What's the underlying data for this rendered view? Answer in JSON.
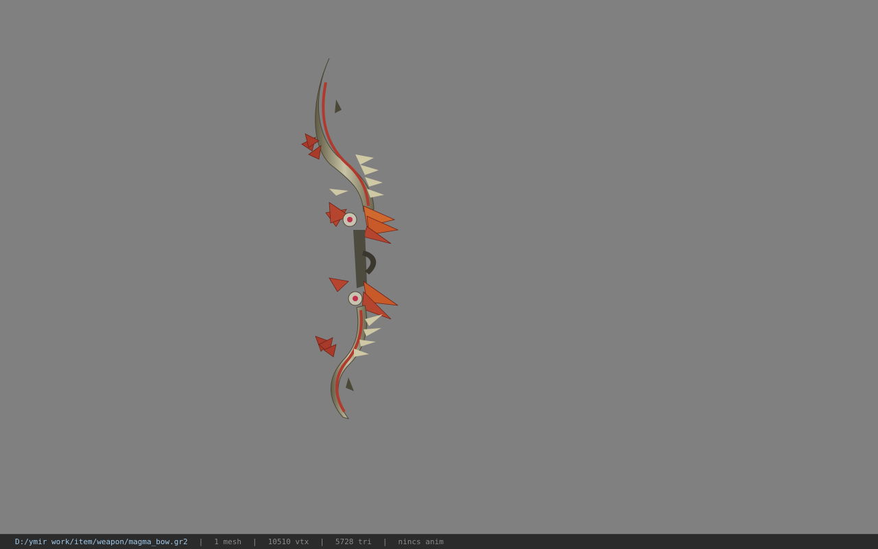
{
  "viewer": {
    "background_color": "#808080",
    "model": {
      "icon": "bow-model-render"
    }
  },
  "statusbar": {
    "file_path": "D:/ymir work/item/weapon/magma_bow.gr2",
    "separator": "|",
    "mesh_count": "1 mesh",
    "vertex_count": "10510 vtx",
    "triangle_count": "5728 tri",
    "anim_status": "nincs anim",
    "path_color": "#9fc8e8",
    "text_color": "#8a8a8a"
  }
}
